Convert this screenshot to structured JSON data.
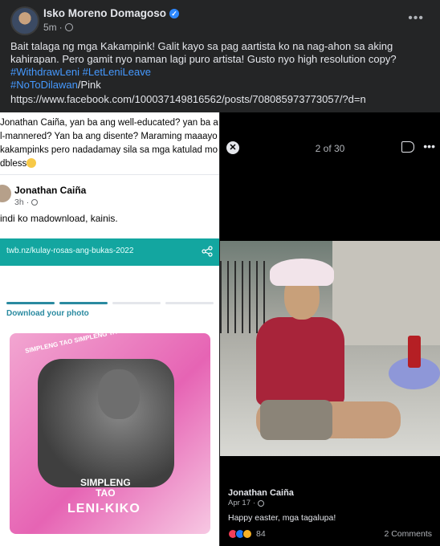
{
  "post": {
    "author": "Isko Moreno Domagoso",
    "time": "5m",
    "text": "Bait talaga ng mga Kakampink! Galit kayo sa pag aartista ko na nag-ahon sa aking kahirapan. Pero gamit nyo naman lagi puro artista! Gusto nyo high resolution copy?",
    "hashtag1": "#WithdrawLeni",
    "hashtag2": "#LetLeniLeave",
    "hashtag3": "#NoToDilawan",
    "hashtag3_suffix": "/Pink",
    "url": "https://www.facebook.com/100037149816562/posts/708085973773057/?d=n",
    "more_icon": "more-horizontal-icon"
  },
  "left_screenshot": {
    "comment_line1": "Jonathan Caiña, yan ba ang well-educated? yan ba a",
    "comment_line2": "l-mannered? Yan ba ang disente? Maraming maaayo",
    "comment_line3": "kakampinks pero nadadamay sila sa mga katulad mo",
    "comment_line4": "dbless",
    "commenter": "Jonathan Caiña",
    "commenter_time": "3h",
    "comment_text": "indi ko madownload, kainis.",
    "link": "twb.nz/kulay-rosas-ang-bukas-2022",
    "download_label": "Download your photo",
    "card_tag1": "SIMPLENG TAO SIMPLENG TAO",
    "card_tag2a": "SIMPLENG",
    "card_tag2b": "TAO",
    "card_tag3": "LENI-KIKO",
    "colors": {
      "link_bar": "#13a6a0",
      "card": "#e664b4"
    }
  },
  "right_screenshot": {
    "counter": "2 of 30",
    "poster": "Jonathan Caiña",
    "date": "Apr 17",
    "caption": "Happy easter, mga tagalupa!",
    "reaction_count": "84",
    "comments": "2 Comments",
    "close_icon": "close-icon",
    "tag_icon": "tag-icon"
  }
}
